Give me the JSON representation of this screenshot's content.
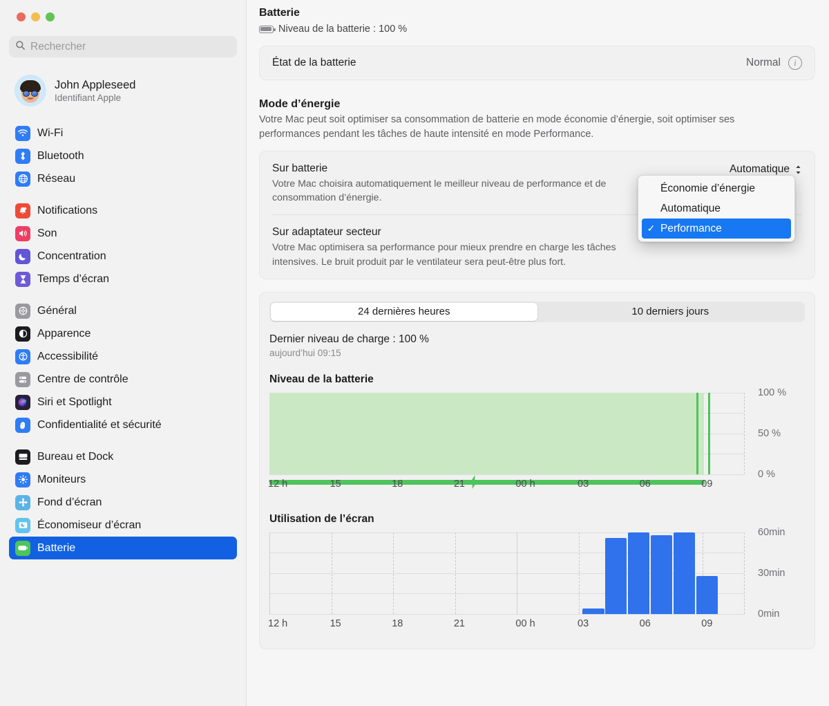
{
  "window": {
    "traffic_lights": [
      "close",
      "minimize",
      "zoom"
    ]
  },
  "sidebar": {
    "search": {
      "placeholder": "Rechercher",
      "value": ""
    },
    "profile": {
      "name": "John Appleseed",
      "subtitle": "Identifiant Apple"
    },
    "groups": [
      {
        "items": [
          {
            "label": "Wi-Fi",
            "icon": "wifi-icon",
            "color": "#2f7cf6",
            "selected": false
          },
          {
            "label": "Bluetooth",
            "icon": "bluetooth-icon",
            "color": "#2f7cf6",
            "selected": false
          },
          {
            "label": "Réseau",
            "icon": "globe-icon",
            "color": "#2f7cf6",
            "selected": false
          }
        ]
      },
      {
        "items": [
          {
            "label": "Notifications",
            "icon": "bell-icon",
            "color": "#ef4a38",
            "selected": false
          },
          {
            "label": "Son",
            "icon": "speaker-icon",
            "color": "#ef3e63",
            "selected": false
          },
          {
            "label": "Concentration",
            "icon": "moon-icon",
            "color": "#6255d6",
            "selected": false
          },
          {
            "label": "Temps d’écran",
            "icon": "hourglass-icon",
            "color": "#6e5ad8",
            "selected": false
          }
        ]
      },
      {
        "items": [
          {
            "label": "Général",
            "icon": "gear-icon",
            "color": "#9a9a9e",
            "selected": false
          },
          {
            "label": "Apparence",
            "icon": "appearance-icon",
            "color": "#1c1c1e",
            "selected": false
          },
          {
            "label": "Accessibilité",
            "icon": "accessibility-icon",
            "color": "#2f7cf6",
            "selected": false
          },
          {
            "label": "Centre de contrôle",
            "icon": "control-center-icon",
            "color": "#9a9a9e",
            "selected": false
          },
          {
            "label": "Siri et Spotlight",
            "icon": "siri-icon",
            "color": "#3c2a4d",
            "selected": false
          },
          {
            "label": "Confidentialité et sécurité",
            "icon": "hand-icon",
            "color": "#2f7cf6",
            "selected": false
          }
        ]
      },
      {
        "items": [
          {
            "label": "Bureau et Dock",
            "icon": "desktop-dock-icon",
            "color": "#1c1c1e",
            "selected": false
          },
          {
            "label": "Moniteurs",
            "icon": "brightness-icon",
            "color": "#2f7cf6",
            "selected": false
          },
          {
            "label": "Fond d’écran",
            "icon": "wallpaper-icon",
            "color": "#5bb4e8",
            "selected": false
          },
          {
            "label": "Économiseur d’écran",
            "icon": "screensaver-icon",
            "color": "#62c3ef",
            "selected": false
          },
          {
            "label": "Batterie",
            "icon": "battery-icon",
            "color": "#4ec45b",
            "selected": true
          }
        ]
      }
    ]
  },
  "main": {
    "title": "Batterie",
    "battery_level_line": "Niveau de la batterie : 100 %",
    "health": {
      "label": "État de la batterie",
      "value": "Normal",
      "info_glyph": "i"
    },
    "energy_mode": {
      "title": "Mode d’énergie",
      "description": "Votre Mac peut soit optimiser sa consommation de batterie en mode économie d’énergie, soit optimiser ses performances pendant les tâches de haute intensité en mode Performance.",
      "on_battery": {
        "label": "Sur batterie",
        "description": "Votre Mac choisira automatiquement le meilleur niveau de performance et de consommation d’énergie.",
        "selected_value": "Automatique"
      },
      "on_power": {
        "label": "Sur adaptateur secteur",
        "description": "Votre Mac optimisera sa performance pour mieux prendre en charge les tâches intensives. Le bruit produit par le ventilateur sera peut-être plus fort."
      },
      "menu": {
        "open": true,
        "options": [
          {
            "label": "Économie d’énergie",
            "checked": false
          },
          {
            "label": "Automatique",
            "checked": false
          },
          {
            "label": "Performance",
            "checked": true
          }
        ],
        "check_glyph": "✓",
        "highlight_color": "#1877f2"
      }
    },
    "usage": {
      "tabs": [
        {
          "label": "24 dernières heures",
          "active": true
        },
        {
          "label": "10 derniers jours",
          "active": false
        }
      ],
      "last_charge_label": "Dernier niveau de charge : 100 %",
      "last_charge_time": "aujourd’hui 09:15"
    }
  },
  "chart_data": [
    {
      "type": "area",
      "title": "Niveau de la batterie",
      "xlabel": "",
      "ylabel": "",
      "ylim": [
        0,
        100
      ],
      "yticks": [
        0,
        50,
        100
      ],
      "ytick_labels": [
        "0 %",
        "50 %",
        "100 %"
      ],
      "x_tick_labels": [
        "12 h",
        "15",
        "18",
        "21",
        "00 h",
        "03",
        "06",
        "09"
      ],
      "x_tick_hours": [
        12,
        15,
        18,
        21,
        24,
        27,
        30,
        33
      ],
      "x_range_hours": [
        12,
        35
      ],
      "grid": true,
      "series": [
        {
          "name": "Niveau de la batterie",
          "color": "#4ec45b",
          "fill_color": "#cbe8c4",
          "x": [
            12,
            15,
            18,
            21,
            24,
            27,
            30,
            33,
            33.2
          ],
          "values": [
            100,
            100,
            100,
            100,
            100,
            100,
            100,
            100,
            100
          ]
        }
      ],
      "charging_periods": [
        {
          "start_hour": 12,
          "end_hour": 33.1,
          "label": "en charge"
        }
      ],
      "annotations": [
        {
          "icon": "bolt-icon",
          "hour": 21.9,
          "label": "branché sur secteur"
        }
      ]
    },
    {
      "type": "bar",
      "title": "Utilisation de l’écran",
      "xlabel": "",
      "ylabel": "",
      "ylim": [
        0,
        60
      ],
      "yticks": [
        0,
        30,
        60
      ],
      "ytick_labels": [
        "0min",
        "30min",
        "60min"
      ],
      "x_tick_labels": [
        "12 h",
        "15",
        "18",
        "21",
        "00 h",
        "03",
        "06",
        "09"
      ],
      "x_tick_hours": [
        12,
        15,
        18,
        21,
        24,
        27,
        30,
        33
      ],
      "x_range_hours": [
        12,
        35
      ],
      "grid": true,
      "bar_color": "#2f72ec",
      "categories": [
        "04",
        "05",
        "06",
        "07",
        "08",
        "09"
      ],
      "bar_hours": [
        27.7,
        28.8,
        29.9,
        31.0,
        32.1,
        33.2
      ],
      "values": [
        4,
        56,
        60,
        58,
        60,
        28
      ]
    }
  ]
}
